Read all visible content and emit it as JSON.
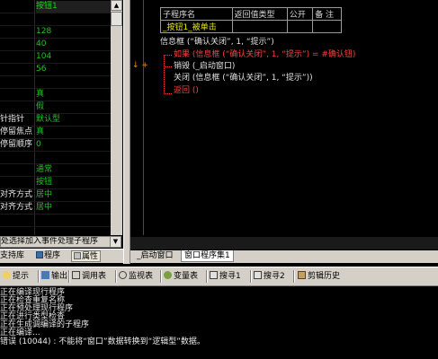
{
  "properties": [
    {
      "name": "",
      "value": "按钮1",
      "selected": true
    },
    {
      "name": "",
      "value": ""
    },
    {
      "name": "",
      "value": "128"
    },
    {
      "name": "",
      "value": "40"
    },
    {
      "name": "",
      "value": "104"
    },
    {
      "name": "",
      "value": "56"
    },
    {
      "name": "",
      "value": ""
    },
    {
      "name": "",
      "value": "真"
    },
    {
      "name": "",
      "value": "假"
    },
    {
      "name": "针指针",
      "value": "默认型"
    },
    {
      "name": "停留焦点",
      "value": "真"
    },
    {
      "name": "停留顺序",
      "value": "0"
    },
    {
      "name": "",
      "value": ""
    },
    {
      "name": "",
      "value": "通常"
    },
    {
      "name": "",
      "value": "按钮"
    },
    {
      "name": "对齐方式",
      "value": "居中"
    },
    {
      "name": "对齐方式",
      "value": "居中"
    },
    {
      "name": "",
      "value": ""
    }
  ],
  "event_combo": {
    "text": "处选择加入事件处理子程序"
  },
  "left_tabs": [
    {
      "label": "支持库"
    },
    {
      "label": "程序"
    },
    {
      "label": "属性"
    }
  ],
  "sub_table": {
    "headers": [
      "子程序名",
      "返回值类型",
      "公开",
      "备 注"
    ],
    "name": "_按钮1_被单击"
  },
  "code": {
    "line1": "信息框 (“确认关闭”, 1, “提示”)",
    "line2": "如果 (信息框 (“确认关闭”, 1, “提示”) = #确认钮)",
    "line3": "销毁 (_启动窗口)",
    "line4": "关闭 (信息框 (“确认关闭”, 1, “提示”))",
    "line5": "返回 ()",
    "markers": "↓ +"
  },
  "editor_tabs": [
    {
      "label": "_启动窗口"
    },
    {
      "label": "窗口程序集1",
      "active": true
    }
  ],
  "output_toolbar": [
    {
      "label": "提示",
      "icon": "info-icon"
    },
    {
      "label": "输出",
      "icon": "output-icon"
    },
    {
      "label": "调用表",
      "icon": "call-table-icon"
    },
    {
      "label": "监视表",
      "icon": "watch-icon"
    },
    {
      "label": "变量表",
      "icon": "variables-icon"
    },
    {
      "label": "搜寻1",
      "icon": "search-icon"
    },
    {
      "label": "搜寻2",
      "icon": "search-icon"
    },
    {
      "label": "剪辑历史",
      "icon": "clipboard-icon"
    }
  ],
  "output_lines": [
    "正在编译现行程序",
    "正在检查重复名称",
    "正在预处理现行程序",
    "正在进行类型检查",
    "正在生成调编译的子程序",
    "正在编译...",
    "错误 (10044) : 不能将“窗口”数据转换到“逻辑型”数据。"
  ],
  "colors": {
    "value_green": "#18c918",
    "keyword_red": "#ff4040",
    "string_yellow": "#e8e800",
    "constant_magenta": "#ff66ff",
    "panel_gray": "#d4d0c8"
  }
}
